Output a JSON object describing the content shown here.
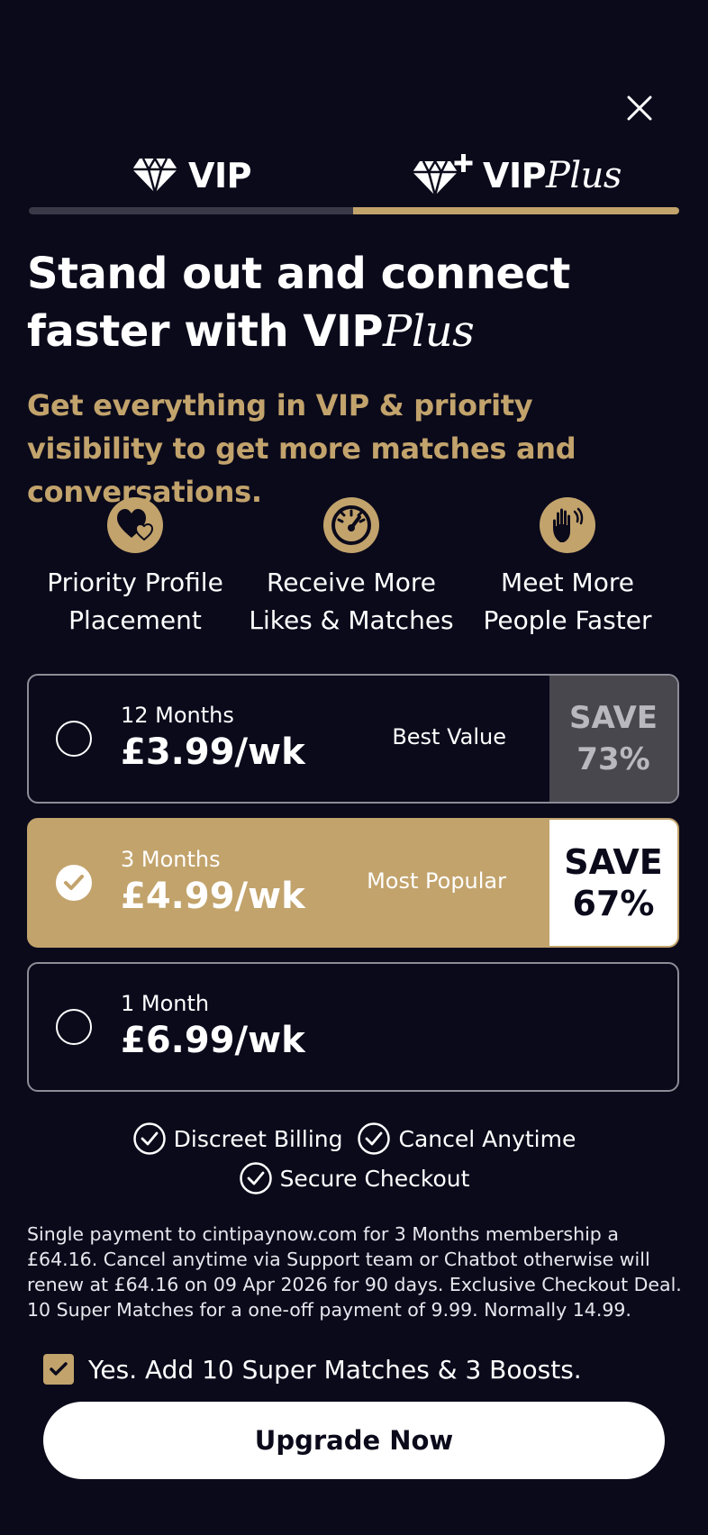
{
  "colors": {
    "background": "#0b0a1b",
    "accent_gold": "#c2a36c",
    "white": "#ffffff"
  },
  "close_icon": "close-icon",
  "tabs": [
    {
      "label_main": "VIP",
      "label_plus": "",
      "icon": "diamond-icon",
      "selected": false
    },
    {
      "label_main": "VIP",
      "label_plus": "Plus",
      "icon": "diamond-plus-icon",
      "selected": true
    }
  ],
  "headline": {
    "line1": "Stand out and connect",
    "line2_prefix": "faster with VIP",
    "line2_plus": "Plus"
  },
  "subheadline": "Get everything in VIP & priority visibility to get more matches and conversations.",
  "features": [
    {
      "icon": "hearts-icon",
      "line1": "Priority Profile",
      "line2": "Placement"
    },
    {
      "icon": "speedometer-icon",
      "line1": "Receive More",
      "line2": "Likes & Matches"
    },
    {
      "icon": "waving-hand-icon",
      "line1": "Meet More",
      "line2": "People Faster"
    }
  ],
  "plans": [
    {
      "duration": "12 Months",
      "price": "£3.99/wk",
      "tagline": "Best Value",
      "save_label": "SAVE",
      "save_value": "73%",
      "selected": false
    },
    {
      "duration": "3 Months",
      "price": "£4.99/wk",
      "tagline": "Most Popular",
      "save_label": "SAVE",
      "save_value": "67%",
      "selected": true
    },
    {
      "duration": "1 Month",
      "price": "£6.99/wk",
      "tagline": "",
      "save_label": "",
      "save_value": "",
      "selected": false
    }
  ],
  "badges": [
    "Discreet Billing",
    "Cancel Anytime",
    "Secure Checkout"
  ],
  "legal": "Single payment to cintipaynow.com for 3 Months membership a £64.16. Cancel anytime via Support team or Chatbot otherwise will renew at £64.16 on 09 Apr 2026  for 90 days. Exclusive Checkout Deal. 10 Super Matches for a one-off payment of 9.99. Normally 14.99.",
  "addon": {
    "label": "Yes. Add 10 Super Matches & 3 Boosts.",
    "checked": true
  },
  "cta_label": "Upgrade Now"
}
